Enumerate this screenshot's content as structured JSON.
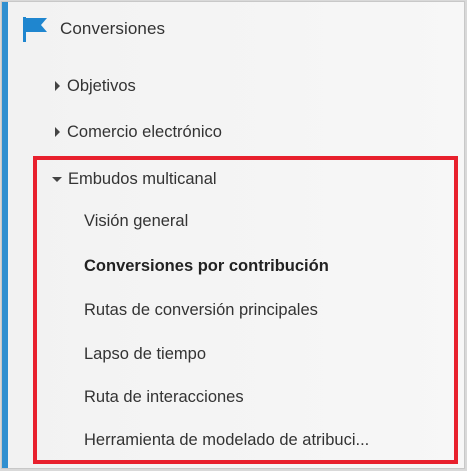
{
  "section": {
    "title": "Conversiones",
    "icon": "flag-icon",
    "accent_color": "#2f8fd0"
  },
  "nav": {
    "objetivos": "Objetivos",
    "comercio": "Comercio electrónico",
    "embudos": "Embudos multicanal"
  },
  "embudos_items": [
    "Visión general",
    "Conversiones por contribución",
    "Rutas de conversión principales",
    "Lapso de tiempo",
    "Ruta de interacciones",
    "Herramienta de modelado de atribuci..."
  ],
  "active_item": "Conversiones por contribución",
  "highlight_color": "#e8202d"
}
